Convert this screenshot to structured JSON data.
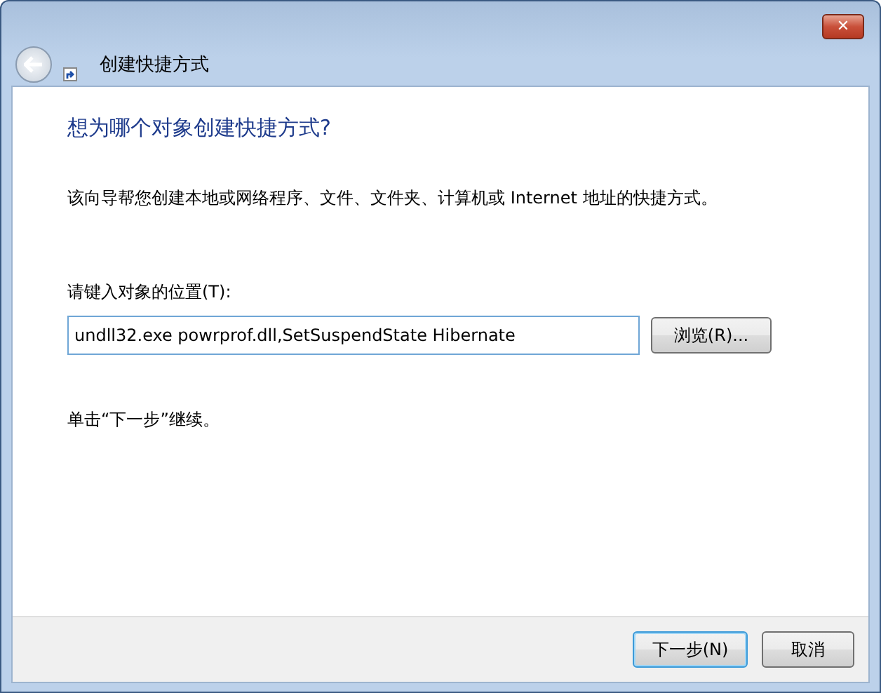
{
  "window": {
    "title": "创建快捷方式",
    "close_label": "✕"
  },
  "heading": "想为哪个对象创建快捷方式?",
  "description": "该向导帮您创建本地或网络程序、文件、文件夹、计算机或 Internet 地址的快捷方式。",
  "location": {
    "label": "请键入对象的位置(T):",
    "value": "undll32.exe powrprof.dll,SetSuspendState Hibernate",
    "focused": true,
    "browse": "浏览(R)..."
  },
  "hint": "单击“下一步”继续。",
  "buttons": [
    {
      "label": "下一步(N)",
      "default": true
    },
    {
      "label": "取消",
      "default": false
    }
  ]
}
